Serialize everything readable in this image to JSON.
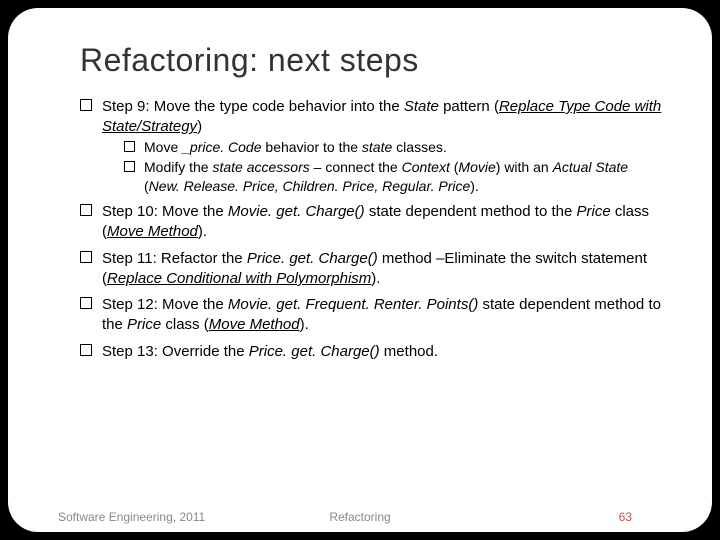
{
  "title": "Refactoring: next steps",
  "steps": {
    "s9": {
      "runs": [
        {
          "t": "Step 9: Move the type code behavior into the "
        },
        {
          "t": "State",
          "i": true
        },
        {
          "t": " pattern ("
        },
        {
          "t": "Replace Type Code with State/Strategy",
          "i": true,
          "u": true
        },
        {
          "t": ")"
        }
      ],
      "sub": [
        {
          "runs": [
            {
              "t": "Move "
            },
            {
              "t": "_price. Code",
              "i": true
            },
            {
              "t": " behavior to the "
            },
            {
              "t": "state",
              "i": true
            },
            {
              "t": " classes."
            }
          ]
        },
        {
          "runs": [
            {
              "t": "Modify the "
            },
            {
              "t": "state accessors",
              "i": true
            },
            {
              "t": " – connect the "
            },
            {
              "t": "Context",
              "i": true
            },
            {
              "t": " ("
            },
            {
              "t": "Movie",
              "i": true
            },
            {
              "t": ") with an "
            },
            {
              "t": "Actual State",
              "i": true
            },
            {
              "t": " ("
            },
            {
              "t": "New. Release. Price, Children. Price, Regular. Price",
              "i": true
            },
            {
              "t": ")."
            }
          ]
        }
      ]
    },
    "s10": {
      "runs": [
        {
          "t": "Step 10: Move the "
        },
        {
          "t": "Movie. get. Charge()",
          "i": true
        },
        {
          "t": " state dependent method to the "
        },
        {
          "t": "Price",
          "i": true
        },
        {
          "t": " class ("
        },
        {
          "t": "Move Method",
          "i": true,
          "u": true
        },
        {
          "t": ")."
        }
      ]
    },
    "s11": {
      "runs": [
        {
          "t": "Step 11: Refactor the "
        },
        {
          "t": "Price. get. Charge()",
          "i": true
        },
        {
          "t": " method –Eliminate the switch statement ("
        },
        {
          "t": "Replace Conditional with Polymorphism",
          "i": true,
          "u": true
        },
        {
          "t": ")."
        }
      ]
    },
    "s12": {
      "runs": [
        {
          "t": "Step 12: Move the "
        },
        {
          "t": "Movie. get. Frequent. Renter. Points()",
          "i": true
        },
        {
          "t": " state dependent method to the "
        },
        {
          "t": "Price",
          "i": true
        },
        {
          "t": " class ("
        },
        {
          "t": "Move Method",
          "i": true,
          "u": true
        },
        {
          "t": ")."
        }
      ]
    },
    "s13": {
      "runs": [
        {
          "t": "Step 13: Override the "
        },
        {
          "t": "Price. get. Charge()",
          "i": true
        },
        {
          "t": " method."
        }
      ]
    }
  },
  "footer": {
    "left": "Software Engineering, 2011",
    "center": "Refactoring",
    "pageNumber": "63"
  }
}
